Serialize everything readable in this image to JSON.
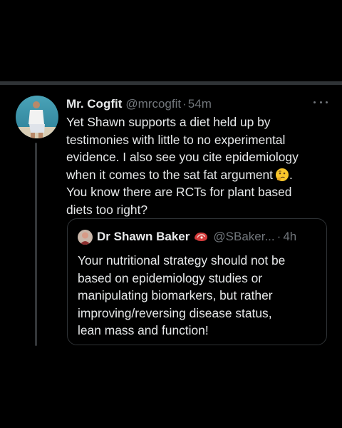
{
  "colors": {
    "background": "#000000",
    "text_primary": "#e7e9ea",
    "text_secondary": "#71767b",
    "border": "#2f3336"
  },
  "tweet": {
    "author_name": "Mr. Cogfit",
    "handle": "@mrcogfit",
    "separator": "·",
    "time": "54m",
    "more_icon": "more-dots-icon",
    "text_lines": [
      "Yet Shawn supports a diet held up by",
      "testimonies with little to no experimental",
      "evidence. I also see you cite epidemiology",
      "when it comes to the sat fat argument",
      "You know there are RCTs for plant based",
      "diets too right?"
    ],
    "inline_emoji": "thinking-face-icon",
    "inline_emoji_trailing": "."
  },
  "quoted_tweet": {
    "author_name": "Dr Shawn Baker",
    "name_emoji": "steak-icon",
    "handle": "@SBaker...",
    "separator": "·",
    "time": "4h",
    "text_lines": [
      "Your nutritional strategy should not be",
      "based on epidemiology studies or",
      "manipulating biomarkers, but rather",
      "improving/reversing disease status,",
      "lean mass and function!"
    ]
  }
}
